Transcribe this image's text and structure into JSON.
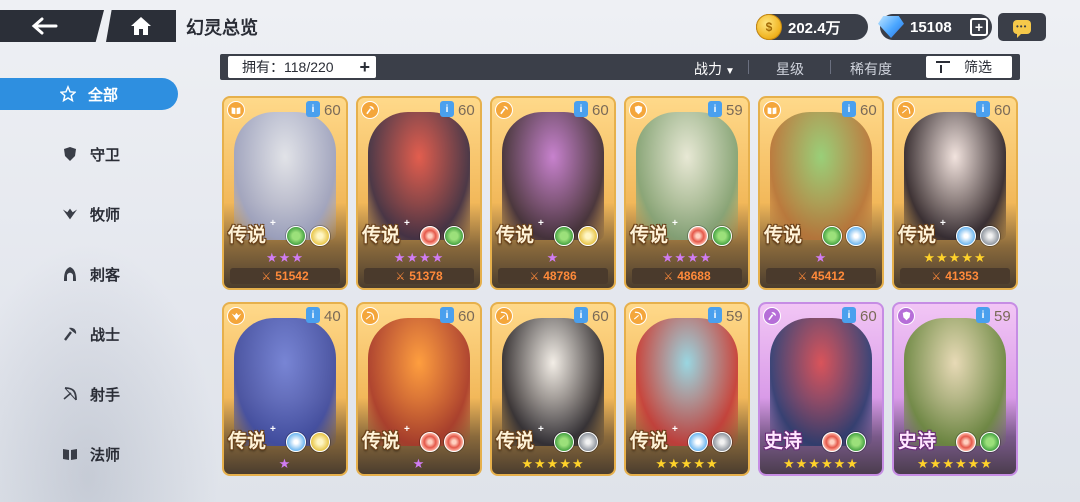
{
  "header": {
    "title": "幻灵总览",
    "gold": "202.4万",
    "gems": "15108"
  },
  "filter": {
    "own_label": "拥有：118/220",
    "sort_power": "战力",
    "sort_star": "星级",
    "sort_rarity": "稀有度",
    "screen": "筛选"
  },
  "sidebar": {
    "items": [
      {
        "label": "全部",
        "icon": "star-outline-icon",
        "active": true
      },
      {
        "label": "守卫",
        "icon": "shield-icon"
      },
      {
        "label": "牧师",
        "icon": "wings-icon"
      },
      {
        "label": "刺客",
        "icon": "hood-icon"
      },
      {
        "label": "战士",
        "icon": "axe-icon"
      },
      {
        "label": "射手",
        "icon": "bow-icon"
      },
      {
        "label": "法师",
        "icon": "book-icon"
      }
    ]
  },
  "cards": [
    {
      "level": "60",
      "rarity": "传说",
      "class": "book-icon",
      "elements": [
        "nature",
        "light"
      ],
      "stars": 3,
      "star_color": "purple",
      "power": "51542",
      "plus": true,
      "art": [
        "#dfe6f5",
        "#9aa3c8"
      ]
    },
    {
      "level": "60",
      "rarity": "传说",
      "class": "axe-icon",
      "elements": [
        "fire",
        "nature"
      ],
      "stars": 4,
      "star_color": "purple",
      "power": "51378",
      "plus": true,
      "art": [
        "#e0524a",
        "#3a2a44"
      ]
    },
    {
      "level": "60",
      "rarity": "传说",
      "class": "axe-icon",
      "elements": [
        "nature",
        "light"
      ],
      "stars": 1,
      "star_color": "purple",
      "power": "48786",
      "plus": true,
      "art": [
        "#c27ad8",
        "#3a2a3a"
      ]
    },
    {
      "level": "59",
      "rarity": "传说",
      "class": "shield-icon",
      "elements": [
        "fire",
        "nature"
      ],
      "stars": 4,
      "star_color": "purple",
      "power": "48688",
      "plus": true,
      "art": [
        "#e6ece0",
        "#7fa37a"
      ]
    },
    {
      "level": "60",
      "rarity": "传说",
      "class": "book-icon",
      "elements": [
        "nature",
        "water"
      ],
      "stars": 1,
      "star_color": "purple",
      "power": "45412",
      "plus": false,
      "art": [
        "#8fd07a",
        "#b5743a"
      ]
    },
    {
      "level": "60",
      "rarity": "传说",
      "class": "bow-icon",
      "elements": [
        "water",
        "gray"
      ],
      "stars": 5,
      "star_color": "yellow",
      "power": "41353",
      "plus": true,
      "art": [
        "#f1e6ea",
        "#2a2430"
      ]
    },
    {
      "level": "40",
      "rarity": "传说",
      "class": "wings-icon",
      "elements": [
        "water",
        "light"
      ],
      "stars": 1,
      "star_color": "purple",
      "power": "",
      "plus": true,
      "art": [
        "#6a7ee0",
        "#3a4aa8"
      ]
    },
    {
      "level": "60",
      "rarity": "传说",
      "class": "bow-icon",
      "elements": [
        "fire",
        "fire"
      ],
      "stars": 1,
      "star_color": "purple",
      "power": "",
      "plus": true,
      "art": [
        "#ff9a3a",
        "#a8382a"
      ]
    },
    {
      "level": "60",
      "rarity": "传说",
      "class": "bow-icon",
      "elements": [
        "nature",
        "gray"
      ],
      "stars": 5,
      "star_color": "yellow",
      "power": "",
      "plus": true,
      "art": [
        "#f2f2f4",
        "#2a2a34"
      ]
    },
    {
      "level": "59",
      "rarity": "传说",
      "class": "bow-icon",
      "elements": [
        "water",
        "gray"
      ],
      "stars": 5,
      "star_color": "yellow",
      "power": "",
      "plus": true,
      "art": [
        "#8fd8ee",
        "#c33a3a"
      ]
    },
    {
      "level": "60",
      "rarity": "史诗",
      "class": "axe-icon",
      "elements": [
        "fire",
        "nature"
      ],
      "stars": 6,
      "star_color": "yellow",
      "power": "",
      "plus": false,
      "art": [
        "#d84a4a",
        "#2a3a6a"
      ]
    },
    {
      "level": "59",
      "rarity": "史诗",
      "class": "shield-icon",
      "elements": [
        "fire",
        "nature"
      ],
      "stars": 6,
      "star_color": "yellow",
      "power": "",
      "plus": false,
      "art": [
        "#e8dfb0",
        "#6a8a3a"
      ]
    }
  ]
}
